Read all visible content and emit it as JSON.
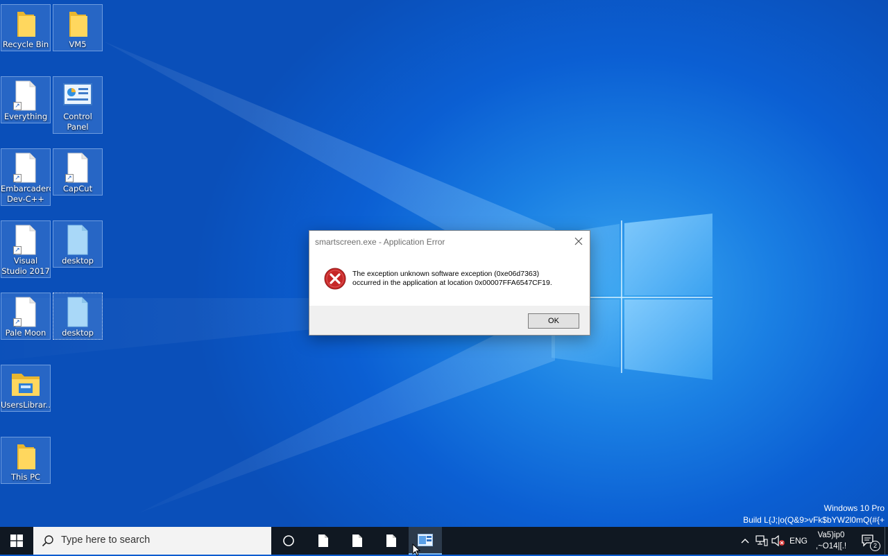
{
  "desktop_icons": [
    {
      "label": "Recycle Bin",
      "icon": "folder-icon"
    },
    {
      "label": "VM5",
      "icon": "folder-icon"
    },
    {
      "label": "Everything",
      "icon": "file-shortcut-icon"
    },
    {
      "label": "Control Panel",
      "icon": "control-panel-icon"
    },
    {
      "label": "Embarcadero Dev-C++",
      "icon": "file-shortcut-icon"
    },
    {
      "label": "CapCut",
      "icon": "file-shortcut-icon"
    },
    {
      "label": "Visual Studio 2017",
      "icon": "file-shortcut-icon"
    },
    {
      "label": "desktop",
      "icon": "file-icon"
    },
    {
      "label": "Pale Moon",
      "icon": "file-shortcut-icon"
    },
    {
      "label": "desktop",
      "icon": "file-icon"
    },
    {
      "label": "UsersLibrar...",
      "icon": "library-folder-icon"
    },
    {
      "label": "This PC",
      "icon": "folder-icon"
    }
  ],
  "dialog": {
    "title": "smartscreen.exe - Application Error",
    "message_line1": "The exception unknown software exception (0xe06d7363)",
    "message_line2": "occurred in the application at location 0x00007FFA6547CF19.",
    "ok_label": "OK",
    "icon": "error-icon"
  },
  "watermark": {
    "edition": "Windows 10 Pro",
    "build": "Build L{J;|o(Q&9>vFk$bYW2l0mQ(#{+"
  },
  "taskbar": {
    "search_placeholder": "Type here to search",
    "language": "ENG",
    "clock_line1": "Va5)ip0",
    "clock_line2": ",~O14|[.!",
    "notification_count": "2"
  },
  "colors": {
    "taskbar": "#101822",
    "error_red": "#d32f2f",
    "desktop_blue": "#0b5fd3"
  }
}
